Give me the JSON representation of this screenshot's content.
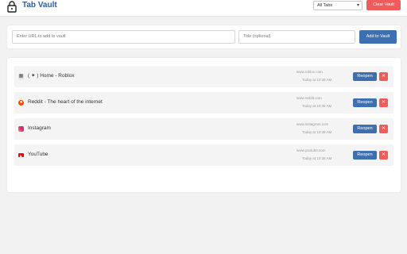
{
  "header": {
    "title": "Tab Vault",
    "filter": {
      "selected": "All Tabs"
    },
    "clear_label": "Clear Vault"
  },
  "add_form": {
    "url_placeholder": "Enter URL to add to vault",
    "title_placeholder": "Title (optional)",
    "add_label": "Add to Vault"
  },
  "tabs": [
    {
      "title": "( ✦ ) Home - Roblox",
      "url": "www.roblox.com",
      "time": "Today at 10:38 AM",
      "icon": "roblox-favicon-icon",
      "reopen_label": "Reopen",
      "delete_label": "✕"
    },
    {
      "title": "Reddit - The heart of the internet",
      "url": "www.reddit.com",
      "time": "Today at 10:38 AM",
      "icon": "reddit-favicon-icon",
      "reopen_label": "Reopen",
      "delete_label": "✕"
    },
    {
      "title": "Instagram",
      "url": "www.instagram.com",
      "time": "Today at 10:38 AM",
      "icon": "instagram-favicon-icon",
      "reopen_label": "Reopen",
      "delete_label": "✕"
    },
    {
      "title": "YouTube",
      "url": "www.youtube.com",
      "time": "Today at 10:38 AM",
      "icon": "youtube-favicon-icon",
      "reopen_label": "Reopen",
      "delete_label": "✕"
    }
  ],
  "colors": {
    "accent": "#3e6fb0",
    "danger": "#f05b5b",
    "title": "#2f5c98"
  }
}
